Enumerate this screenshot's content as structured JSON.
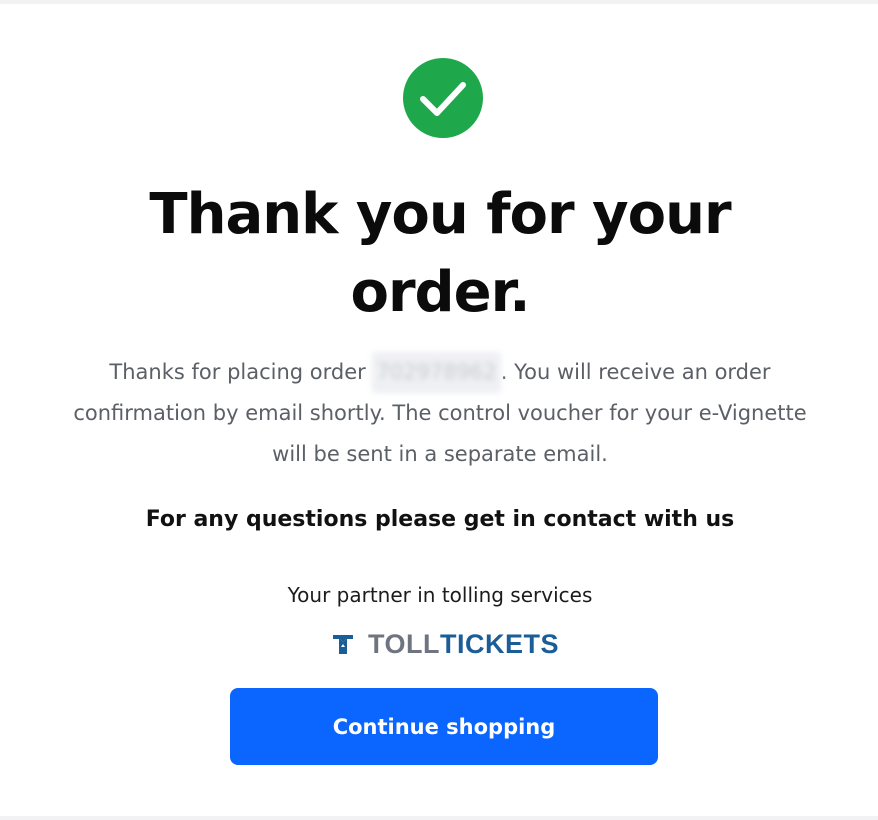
{
  "confirmation": {
    "icon": "check-circle-icon",
    "title": "Thank you for your order.",
    "message_before": "Thanks for placing order ",
    "order_number": "702978962",
    "message_after": ". You will receive an order confirmation by email shortly. The control voucher for your e-Vignette will be sent in a separate email.",
    "questions": "For any questions please get in contact with us",
    "partner_text": "Your partner in tolling services",
    "logo": {
      "icon": "tolltickets-logo-icon",
      "part1": "TOLL",
      "part2": "TICKETS"
    },
    "button_label": "Continue shopping"
  },
  "colors": {
    "success": "#1fa84b",
    "primary_button": "#0a66ff",
    "logo_gray": "#6e7480",
    "logo_blue": "#1b5d96",
    "body_text": "#5b5f66"
  }
}
